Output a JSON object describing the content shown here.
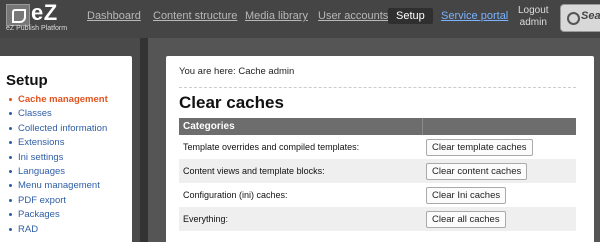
{
  "app": {
    "logo": "eZ",
    "logo_sub": "eZ Publish Platform"
  },
  "nav": {
    "items": [
      "Dashboard",
      "Content structure",
      "Media library",
      "User accounts",
      "Setup",
      "Service portal"
    ],
    "active": "Setup",
    "logout_line1": "Logout",
    "logout_line2": "admin",
    "search_label": "Sea"
  },
  "sidebar": {
    "title": "Setup",
    "items": [
      "Cache management",
      "Classes",
      "Collected information",
      "Extensions",
      "Ini settings",
      "Languages",
      "Menu management",
      "PDF export",
      "Packages",
      "RAD"
    ],
    "current": "Cache management"
  },
  "main": {
    "breadcrumb": "You are here: Cache admin",
    "title": "Clear caches",
    "table": {
      "header": "Categories",
      "rows": [
        {
          "label": "Template overrides and compiled templates:",
          "button": "Clear template caches"
        },
        {
          "label": "Content views and template blocks:",
          "button": "Clear content caches"
        },
        {
          "label": "Configuration (ini) caches:",
          "button": "Clear Ini caches"
        },
        {
          "label": "Everything:",
          "button": "Clear all caches"
        }
      ]
    }
  },
  "colors": {
    "current_item": "#e0531f",
    "link": "#2e5ea6",
    "portal_link": "#7ab2ff",
    "table_header": "#6d6d6d"
  }
}
